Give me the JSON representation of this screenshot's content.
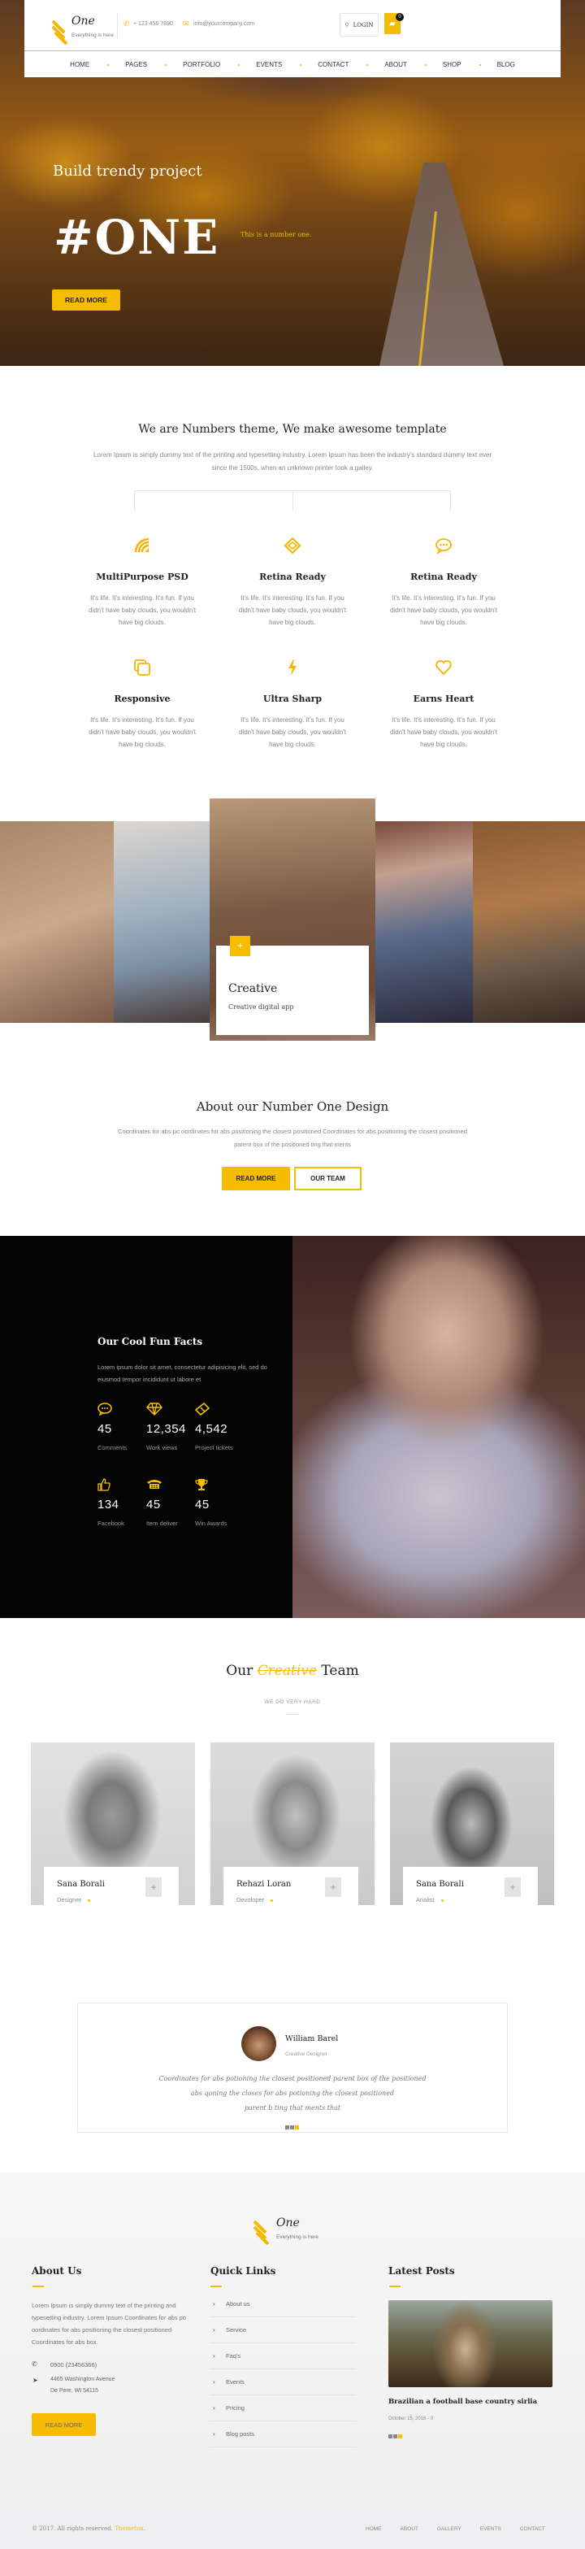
{
  "brand": {
    "name": "One",
    "tagline": "Everything is here",
    "accent": "#f5bc00"
  },
  "header": {
    "phone": "+ 123 456 7890",
    "email": "info@yourcompany.com",
    "login_label": "LOGIN",
    "cart_count": "0",
    "nav": [
      "HOME",
      "PAGES",
      "PORTFOLIO",
      "EVENTS",
      "CONTACT",
      "ABOUT",
      "SHOP",
      "BLOG"
    ]
  },
  "hero": {
    "subtitle": "Build trendy project",
    "title": "#ONE",
    "tagline": "This is a number one.",
    "cta": "READ MORE"
  },
  "intro": {
    "title": "We are Numbers theme, We make awesome template",
    "text": "Lorem Ipsum is simply dummy text of the printing and typesetting industry. Lorem Ipsum has been the industry's standard dummy text ever since the 1500s, when an unknown printer took a galley."
  },
  "features": [
    {
      "icon": "wifi-signal-icon",
      "title": "MultiPurpose PSD",
      "text": "It's life. It's interesting. It's fun. If you didn't have baby clouds, you wouldn't have big clouds."
    },
    {
      "icon": "cube-icon",
      "title": "Retina Ready",
      "text": "It's life. It's interesting. It's fun. If you didn't have baby clouds, you wouldn't have big clouds."
    },
    {
      "icon": "chat-bubble-icon",
      "title": "Retina Ready",
      "text": "It's life. It's interesting. It's fun. If you didn't have baby clouds, you wouldn't have big clouds."
    },
    {
      "icon": "copy-icon",
      "title": "Responsive",
      "text": "It's life. It's interesting. It's fun. If you didn't have baby clouds, you wouldn't have big clouds."
    },
    {
      "icon": "lightning-icon",
      "title": "Ultra Sharp",
      "text": "It's life. It's interesting. It's fun. If you didn't have baby clouds, you wouldn't have big clouds."
    },
    {
      "icon": "heart-icon",
      "title": "Earns Heart",
      "text": "It's life. It's interesting. It's fun. If you didn't have baby clouds, you wouldn't have big clouds."
    }
  ],
  "gallery": {
    "card_title": "Creative",
    "card_subtitle": "Creative digital app",
    "plus": "+"
  },
  "about": {
    "title": "About our Number One Design",
    "text": "Coordinates for abs po oordinates for abs positioning the closest positioned Coordinates for abs positioning the closest positioned parent box of the positioned ting that ments",
    "btn_primary": "READ MORE",
    "btn_secondary": "OUR TEAM"
  },
  "facts": {
    "title": "Our Cool Fun Facts",
    "text": "Lorem ipsum dolor sit amet, consectetur adipisicing elit, sed do eiusmod tempor incididunt ut labore et",
    "items": [
      {
        "icon": "chat-bubble-icon",
        "value": "45",
        "label": "Comments"
      },
      {
        "icon": "diamond-icon",
        "value": "12,354",
        "label": "Work views"
      },
      {
        "icon": "ticket-icon",
        "value": "4,542",
        "label": "Project tickets"
      },
      {
        "icon": "thumbs-up-icon",
        "value": "134",
        "label": "Facebook"
      },
      {
        "icon": "telephone-icon",
        "value": "45",
        "label": "Item deliver"
      },
      {
        "icon": "trophy-icon",
        "value": "45",
        "label": "Win Awards"
      }
    ]
  },
  "team": {
    "title_prefix": "Our",
    "title_highlight": "Creative",
    "title_suffix": "Team",
    "subtitle": "WE DO VERY HARD",
    "members": [
      {
        "name": "Sana Borali",
        "role": "Designer"
      },
      {
        "name": "Rehazi Loran",
        "role": "Devoloper"
      },
      {
        "name": "Sana Borali",
        "role": "Analist"
      }
    ]
  },
  "testimonial": {
    "name": "William Barel",
    "role": "Creative Designer",
    "quote_lines": [
      "Coordinates for abs potioning the closest positioned parent box of the positioned",
      "abs qoning the closes for abs potioning the closest positioned",
      "parent b ting that ments that"
    ]
  },
  "footer": {
    "about": {
      "title": "About Us",
      "text": "Lorem Ipsum is simply dummy text of the printing and typesetting industry. Lorem Ipsum Coordinates for abs po oordinates for abs positioning the closest positioned Coordinates for abs box.",
      "phone": "0900 (23456366)",
      "address_line1": "4465 Washington Avenue",
      "address_line2": "De Pere, WI 54115",
      "cta": "READ MORE"
    },
    "quick_links": {
      "title": "Quick Links",
      "items": [
        "About us",
        "Service",
        "Faq's",
        "Events",
        "Pricing",
        "Blog posts"
      ]
    },
    "latest_posts": {
      "title": "Latest Posts",
      "post_title": "Brazilian a football base country sirlia",
      "post_meta": "October 15, 2016 - 0"
    },
    "copyright_prefix": "© 2017. All rights reserved.",
    "copyright_brand": "Themeton",
    "copyright_suffix": ".",
    "bottom_nav": [
      "HOME",
      "ABOUT",
      "GALLERY",
      "EVENTS",
      "CONTACT"
    ]
  }
}
